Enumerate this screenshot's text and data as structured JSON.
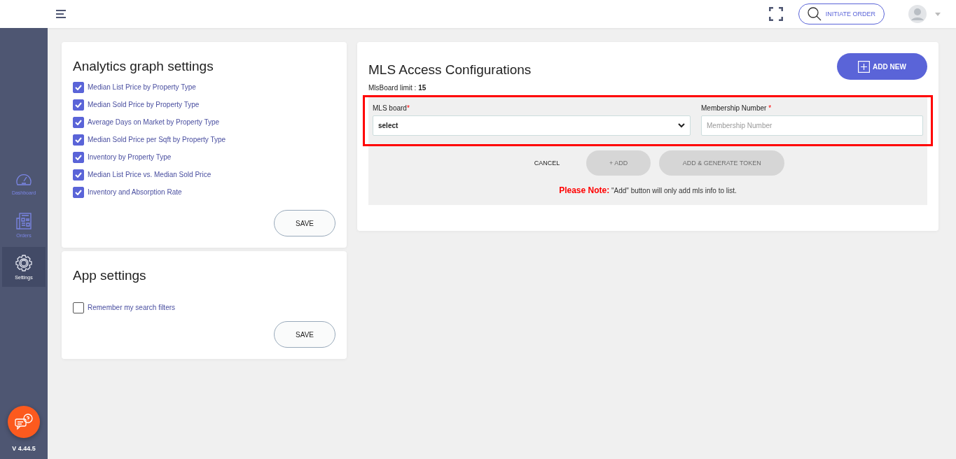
{
  "header": {
    "action": {
      "label": "INITIATE ORDER"
    }
  },
  "sidebar": {
    "items": [
      {
        "kind": "dashboard",
        "label": "Dashboard",
        "selected": false
      },
      {
        "kind": "orders",
        "label": "Orders",
        "selected": false
      },
      {
        "kind": "settings",
        "label": "Settings",
        "selected": true
      }
    ],
    "version": "V 4.44.5"
  },
  "cards": [
    {
      "title": "Analytics graph settings",
      "options": [
        {
          "label": "Median List Price by Property Type",
          "checked": true
        },
        {
          "label": "Median Sold Price by Property Type",
          "checked": true
        },
        {
          "label": "Average Days on Market by Property Type",
          "checked": true
        },
        {
          "label": "Median Sold Price per Sqft by Property Type",
          "checked": true
        },
        {
          "label": "Inventory by Property Type",
          "checked": true
        },
        {
          "label": "Median List Price vs. Median Sold Price",
          "checked": true
        },
        {
          "label": "Inventory and Absorption Rate",
          "checked": true
        }
      ],
      "save": "SAVE"
    },
    {
      "title": "App settings",
      "options": [
        {
          "label": "Remember my search filters",
          "checked": false
        }
      ],
      "save": "SAVE"
    }
  ],
  "mls": {
    "title": "MLS Access Configurations",
    "add_new": "ADD NEW",
    "limit_label": "MlsBoard limit :",
    "limit_value": "15",
    "fields": [
      {
        "kind": "select",
        "label": "MLS board",
        "required_mark": "*",
        "value": "select"
      },
      {
        "kind": "input",
        "label": "Membership Number",
        "required_mark": "*",
        "placeholder": "Membership Number"
      }
    ],
    "buttons": [
      {
        "label": "CANCEL",
        "disabled": false
      },
      {
        "label": "+ ADD",
        "disabled": true
      },
      {
        "label": "ADD & GENERATE TOKEN",
        "disabled": true
      }
    ],
    "note_label": "Please Note:",
    "note_text": "\"Add\" button will only add mls info to list."
  }
}
